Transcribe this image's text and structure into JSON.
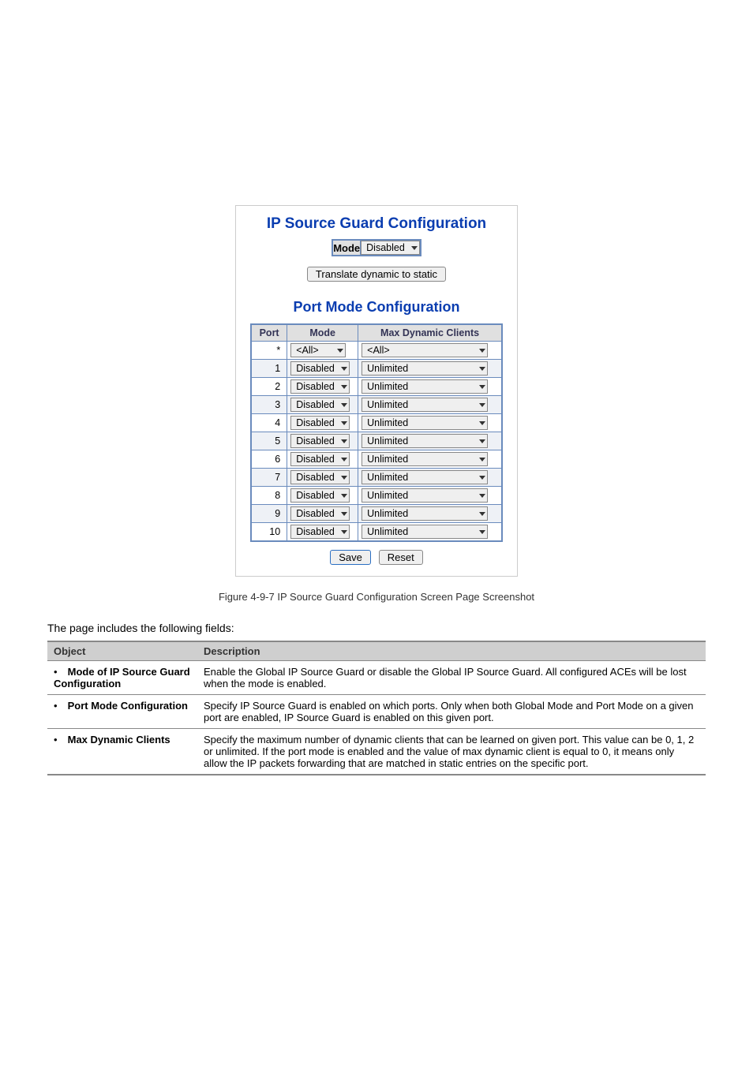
{
  "panel": {
    "title1": "IP Source Guard Configuration",
    "mode_label": "Mode",
    "mode_value": "Disabled",
    "translate_btn": "Translate dynamic to static",
    "title2": "Port Mode Configuration",
    "headers": {
      "port": "Port",
      "mode": "Mode",
      "max": "Max Dynamic Clients"
    },
    "rows": [
      {
        "port": "*",
        "mode": "<All>",
        "max": "<All>"
      },
      {
        "port": "1",
        "mode": "Disabled",
        "max": "Unlimited"
      },
      {
        "port": "2",
        "mode": "Disabled",
        "max": "Unlimited"
      },
      {
        "port": "3",
        "mode": "Disabled",
        "max": "Unlimited"
      },
      {
        "port": "4",
        "mode": "Disabled",
        "max": "Unlimited"
      },
      {
        "port": "5",
        "mode": "Disabled",
        "max": "Unlimited"
      },
      {
        "port": "6",
        "mode": "Disabled",
        "max": "Unlimited"
      },
      {
        "port": "7",
        "mode": "Disabled",
        "max": "Unlimited"
      },
      {
        "port": "8",
        "mode": "Disabled",
        "max": "Unlimited"
      },
      {
        "port": "9",
        "mode": "Disabled",
        "max": "Unlimited"
      },
      {
        "port": "10",
        "mode": "Disabled",
        "max": "Unlimited"
      }
    ],
    "save_btn": "Save",
    "reset_btn": "Reset"
  },
  "caption": "Figure 4-9-7 IP Source Guard Configuration Screen Page Screenshot",
  "desc_intro": "The page includes the following fields:",
  "desc": {
    "head_obj": "Object",
    "head_desc": "Description",
    "rows": [
      {
        "obj": "Mode of IP Source Guard Configuration",
        "desc": "Enable the Global IP Source Guard or disable the Global IP Source Guard. All configured ACEs will be lost when the mode is enabled."
      },
      {
        "obj": "Port Mode Configuration",
        "desc": "Specify IP Source Guard is enabled on which ports. Only when both Global Mode and Port Mode on a given port are enabled, IP Source Guard is enabled on this given port."
      },
      {
        "obj": "Max Dynamic Clients",
        "desc": "Specify the maximum number of dynamic clients that can be learned on given port. This value can be 0, 1, 2 or unlimited. If the port mode is enabled and the value of max dynamic client is equal to 0, it means only allow the IP packets forwarding that are matched in static entries on the specific port."
      }
    ]
  }
}
